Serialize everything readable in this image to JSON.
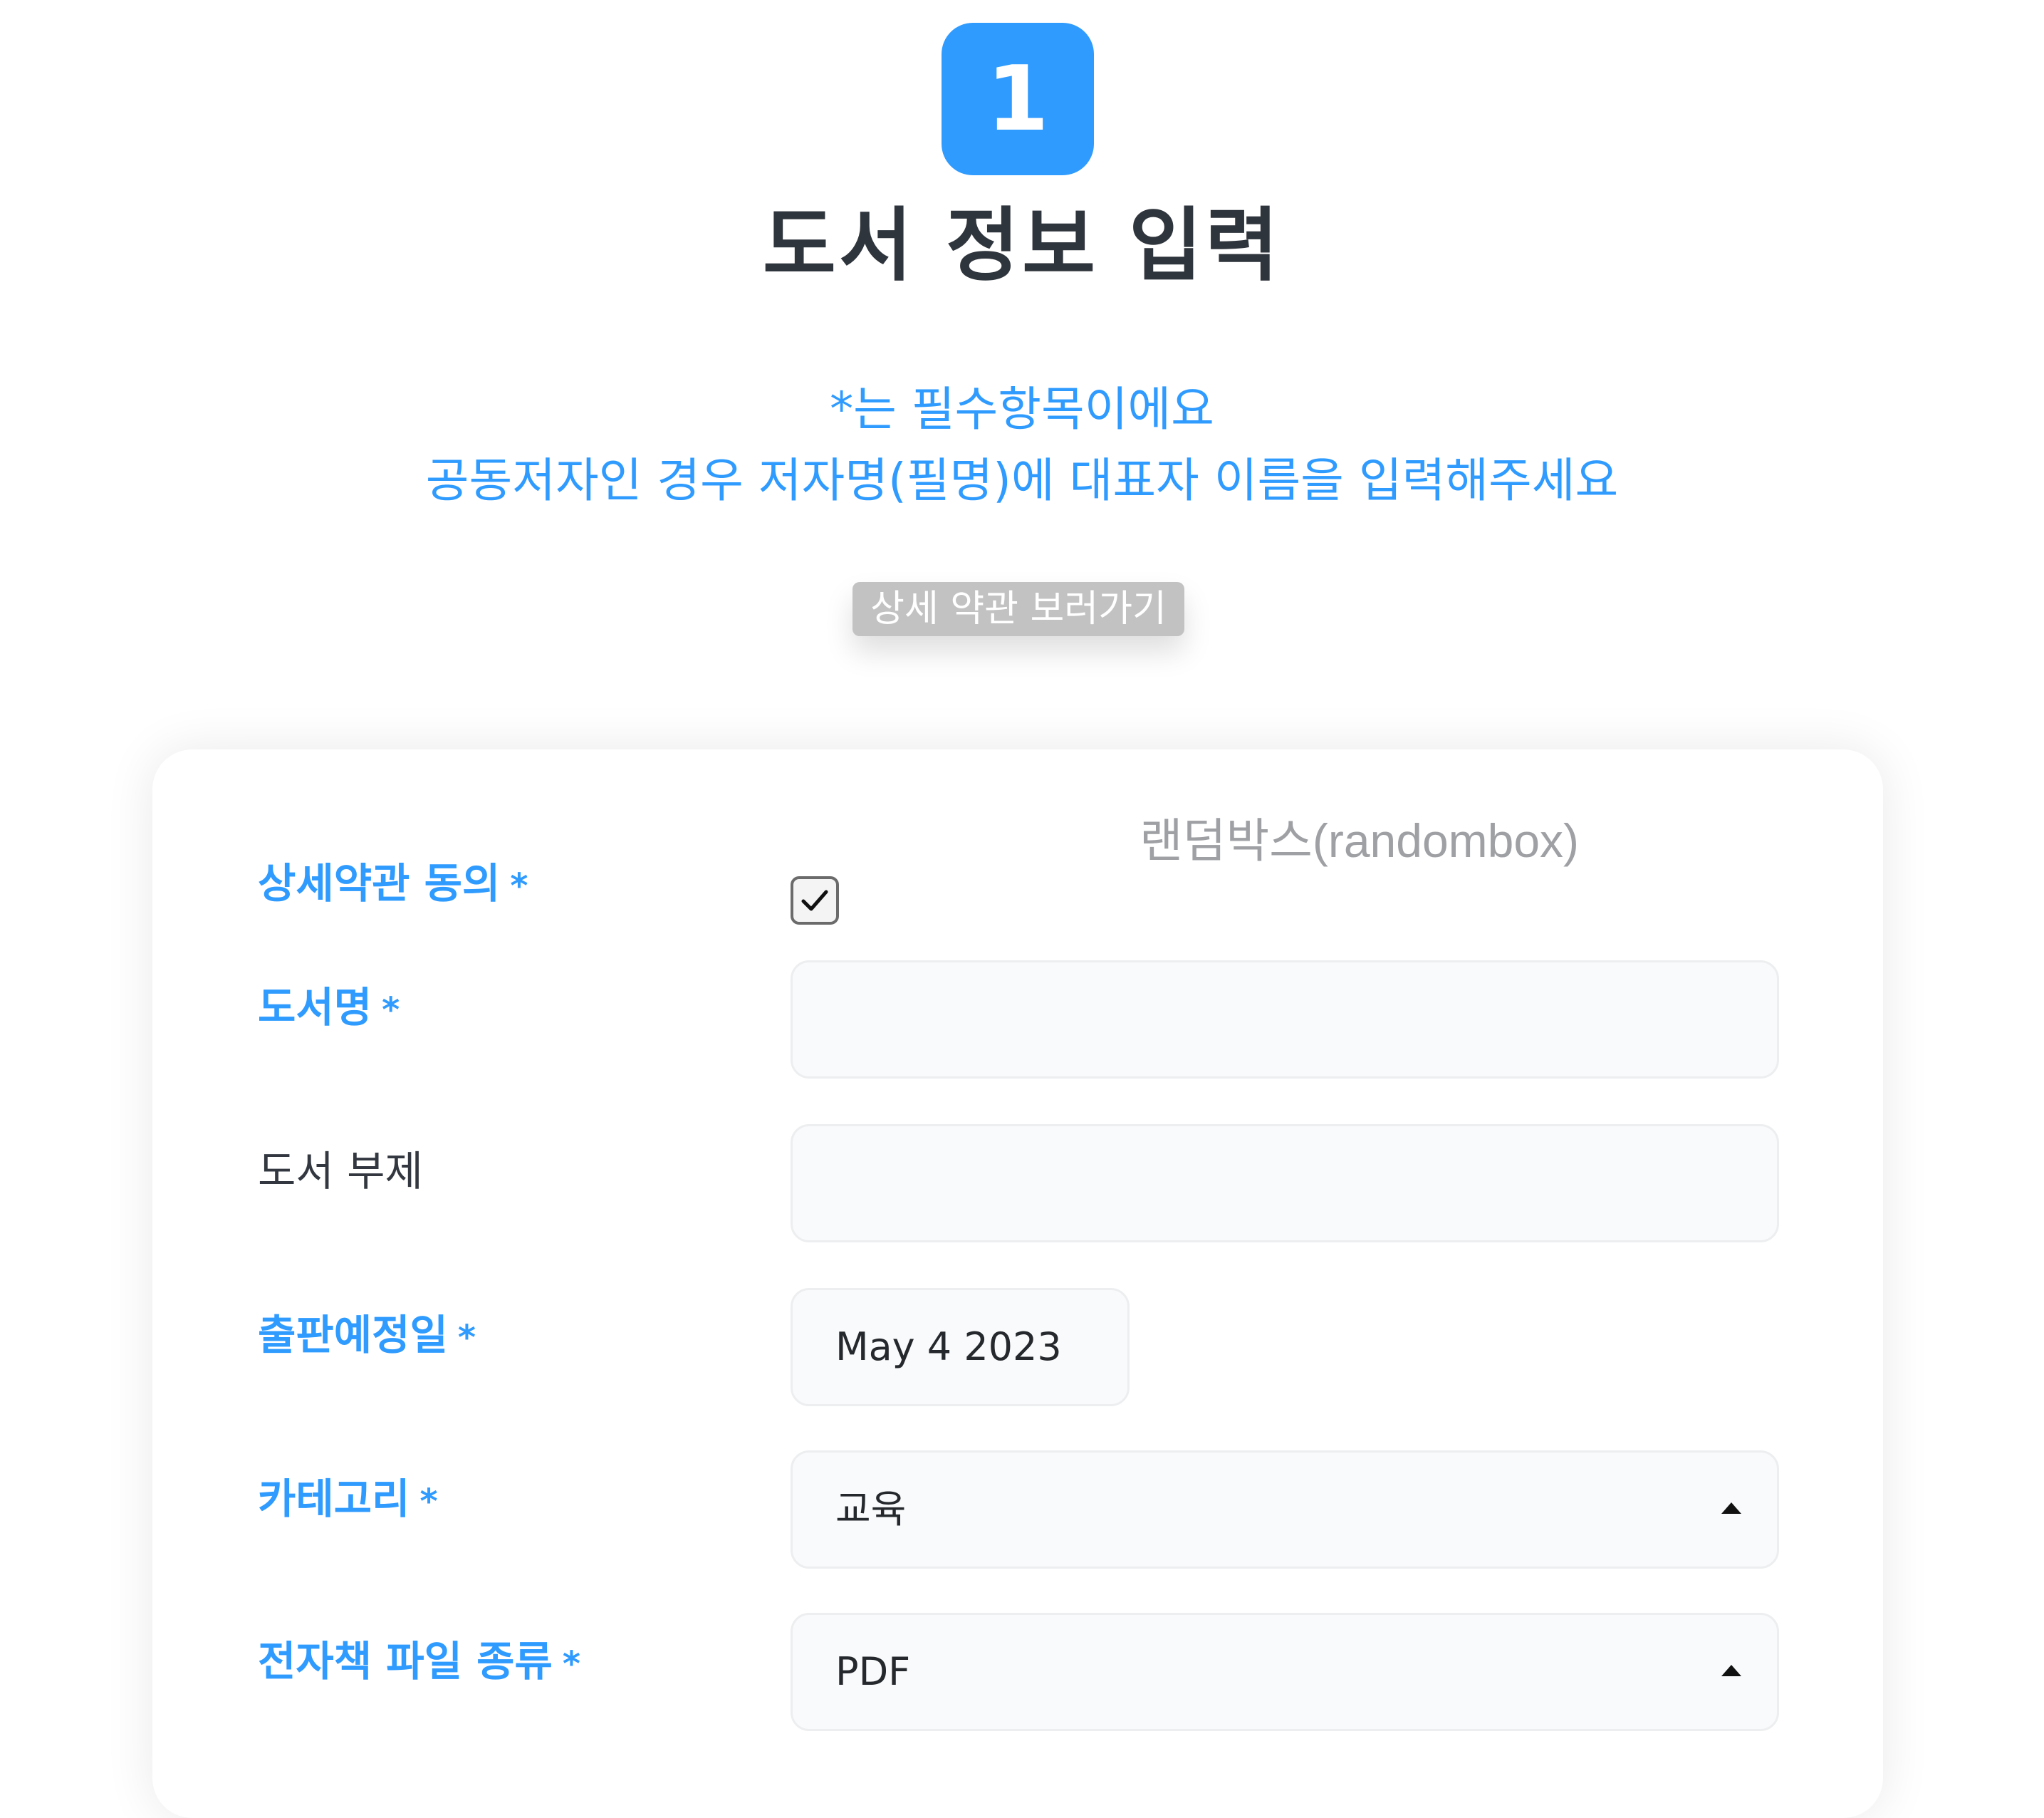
{
  "header": {
    "step_number": "1",
    "title": "도서 정보 입력",
    "notice_required": "*는 필수항목이에요",
    "notice_coauthor": "공동저자인 경우 저자명(필명)에 대표자 이름을 입력해주세요",
    "terms_button_label": "상세 약관 보러가기"
  },
  "form": {
    "brand_text": "랜덤박스(randombox)",
    "required_mark": "*",
    "terms_agree": {
      "label": "상세약관 동의",
      "checked": true
    },
    "book_title": {
      "label": "도서명",
      "value": ""
    },
    "book_subtitle": {
      "label": "도서 부제",
      "value": ""
    },
    "publish_date": {
      "label": "출판예정일",
      "value": "May 4 2023"
    },
    "category": {
      "label": "카테고리",
      "value": "교육"
    },
    "file_type": {
      "label": "전자책 파일 종류",
      "value": "PDF"
    }
  },
  "colors": {
    "accent": "#2f9bff",
    "title": "#2f353c",
    "muted_button": "#c2c2c2",
    "brand_gray": "#9ea0a4",
    "field_bg": "#f9fafb"
  }
}
